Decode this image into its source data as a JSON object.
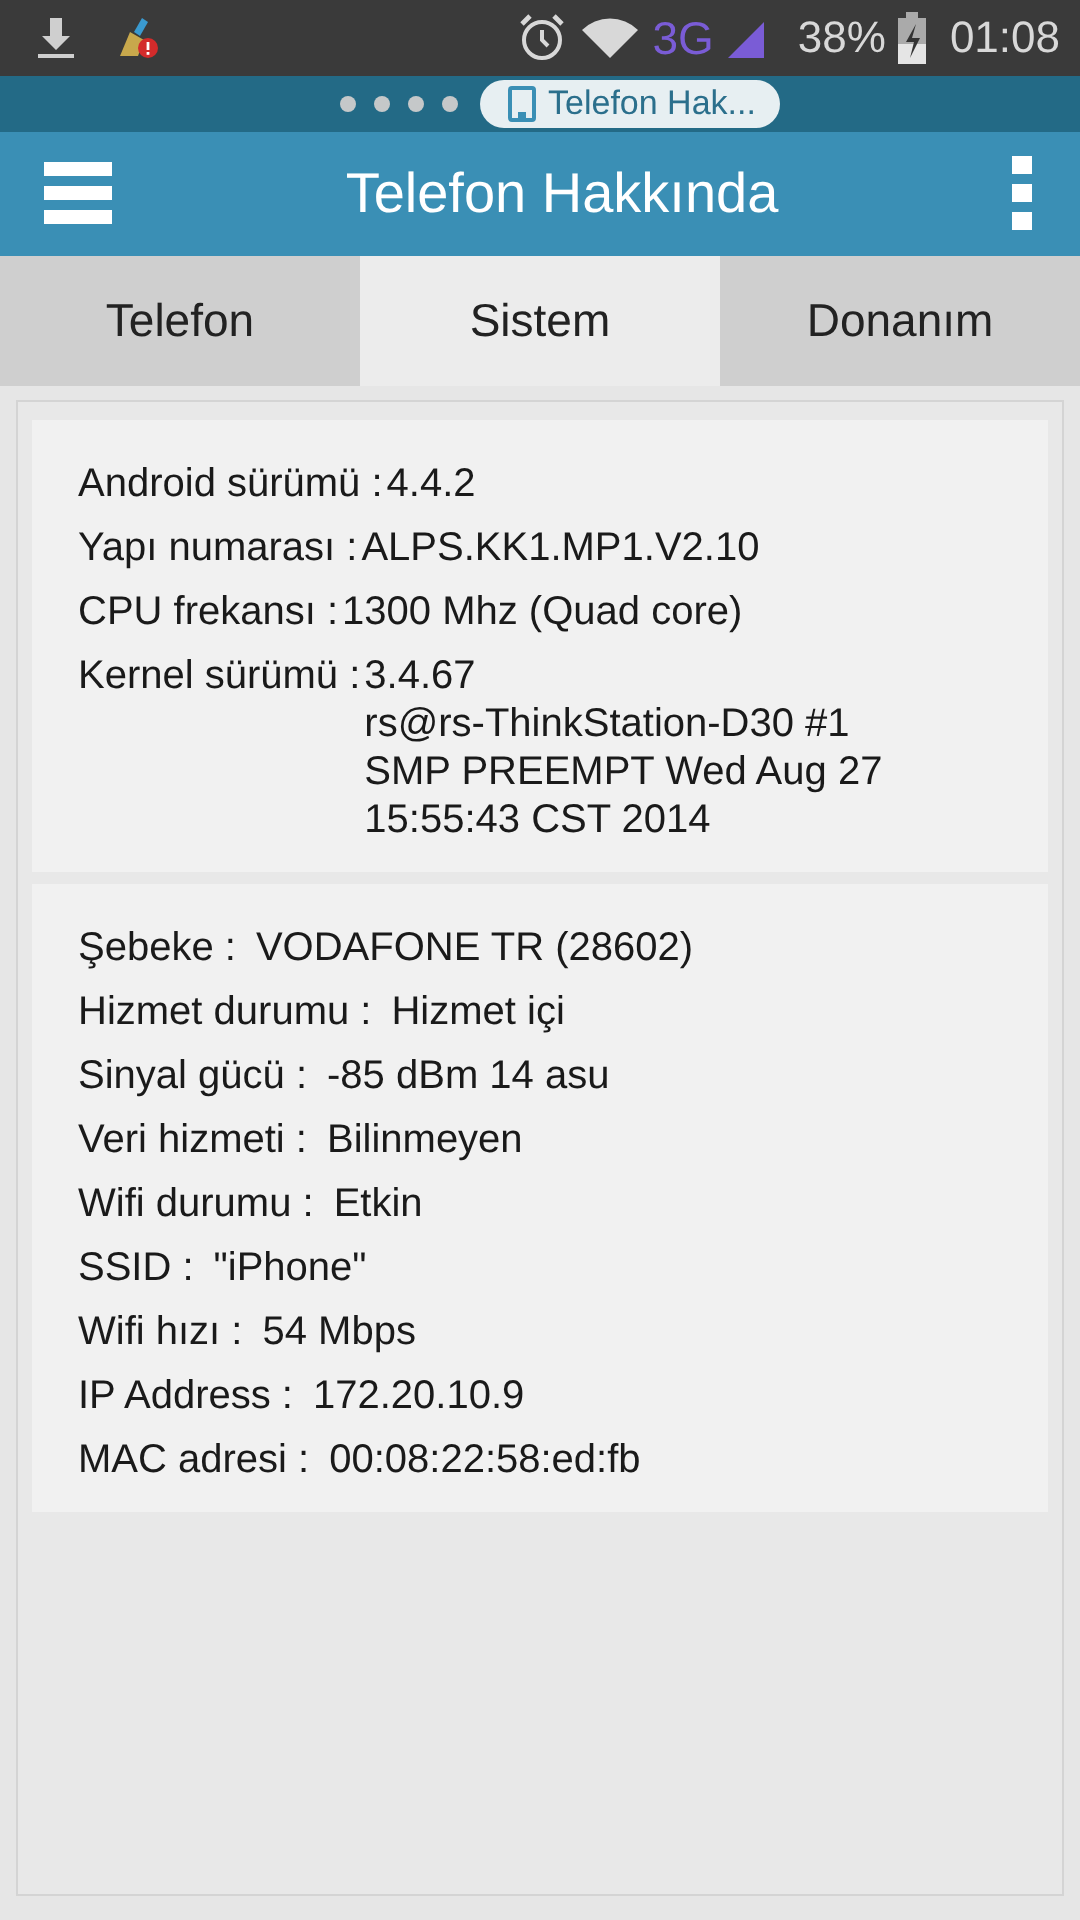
{
  "status_bar": {
    "network": "3G",
    "battery": "38%",
    "time": "01:08"
  },
  "notification_strip": {
    "page_dots": [
      {
        "kind": "dot"
      },
      {
        "kind": "dot"
      },
      {
        "kind": "dot"
      },
      {
        "kind": "dot"
      }
    ],
    "chip": "Telefon Hak..."
  },
  "action_bar": {
    "title": "Telefon Hakkında"
  },
  "tabs": [
    {
      "label": "Telefon",
      "selected": false
    },
    {
      "label": "Sistem",
      "selected": true
    },
    {
      "label": "Donanım",
      "selected": false
    }
  ],
  "cards": [
    {
      "rows": [
        {
          "label": "Android sürümü :",
          "value": [
            "4.4.2"
          ]
        },
        {
          "label": "Yapı numarası :",
          "value": [
            "ALPS.KK1.MP1.V2.10"
          ]
        },
        {
          "label": "CPU frekansı :",
          "value": [
            "1300 Mhz (Quad core)"
          ]
        },
        {
          "label": "Kernel sürümü :",
          "value": [
            "3.4.67",
            "rs@rs-ThinkStation-D30 #1",
            "SMP PREEMPT Wed Aug 27",
            "15:55:43 CST 2014"
          ]
        }
      ]
    },
    {
      "rows": [
        {
          "label": "Şebeke :",
          "value": [
            "VODAFONE TR (28602)"
          ]
        },
        {
          "label": "Hizmet durumu :",
          "value": [
            "Hizmet içi"
          ]
        },
        {
          "label": "Sinyal gücü :",
          "value": [
            "-85 dBm 14 asu"
          ]
        },
        {
          "label": "Veri hizmeti :",
          "value": [
            "Bilinmeyen"
          ]
        },
        {
          "label": "Wifi durumu :",
          "value": [
            "Etkin"
          ]
        },
        {
          "label": "SSID :",
          "value": [
            "\"iPhone\""
          ]
        },
        {
          "label": "Wifi hızı :",
          "value": [
            "54 Mbps"
          ]
        },
        {
          "label": "IP Address :",
          "value": [
            "172.20.10.9"
          ]
        },
        {
          "label": "MAC adresi :",
          "value": [
            "00:08:22:58:ed:fb"
          ]
        }
      ]
    }
  ]
}
